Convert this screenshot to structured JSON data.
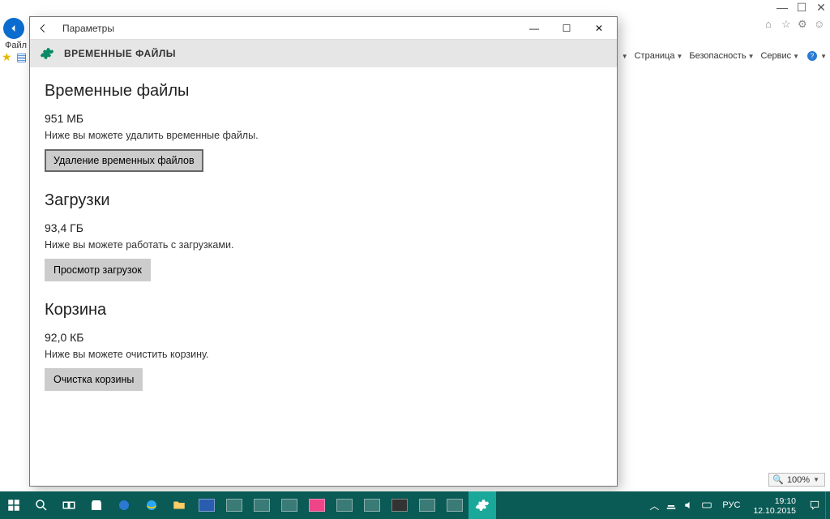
{
  "browser": {
    "file_menu": "Файл",
    "toolbar": {
      "page": "Страница",
      "security": "Безопасность",
      "service": "Сервис"
    },
    "zoom": "100%"
  },
  "settings": {
    "titlebar": "Параметры",
    "header": "ВРЕМЕННЫЕ ФАЙЛЫ",
    "sections": {
      "temp": {
        "title": "Временные файлы",
        "size": "951 МБ",
        "desc": "Ниже вы можете удалить временные файлы.",
        "button": "Удаление временных файлов"
      },
      "downloads": {
        "title": "Загрузки",
        "size": "93,4 ГБ",
        "desc": "Ниже вы можете работать с загрузками.",
        "button": "Просмотр загрузок"
      },
      "recycle": {
        "title": "Корзина",
        "size": "92,0 КБ",
        "desc": "Ниже вы можете очистить корзину.",
        "button": "Очистка корзины"
      }
    }
  },
  "systray": {
    "lang": "РУС",
    "time": "19:10",
    "date": "12.10.2015"
  }
}
